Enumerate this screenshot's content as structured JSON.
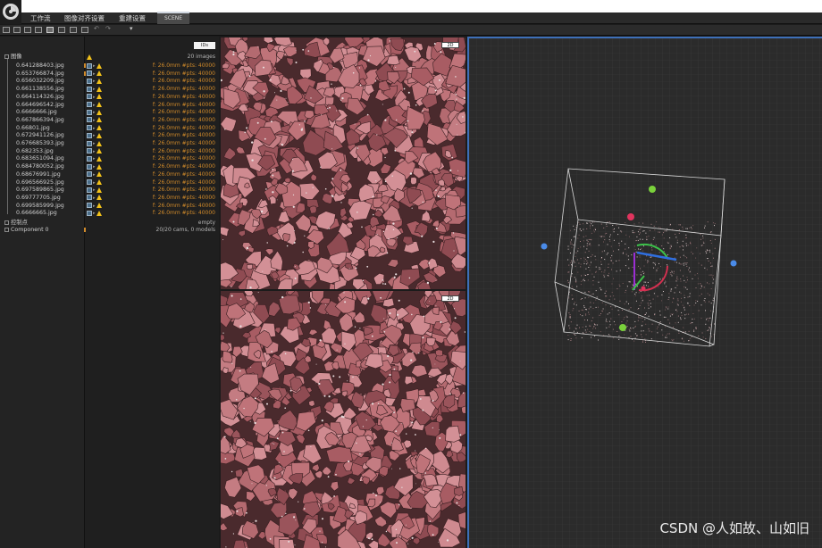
{
  "menu": {
    "items": [
      "工作流",
      "图像对齐设置",
      "重建设置"
    ],
    "scene_tab": "SCENE"
  },
  "tree": {
    "root_label": "图像",
    "images": [
      "0.641288403.jpg",
      "0.653766874.jpg",
      "0.656032209.jpg",
      "0.661138556.jpg",
      "0.664114326.jpg",
      "0.664696542.jpg",
      "0.6666666.jpg",
      "0.667866394.jpg",
      "0.66801.jpg",
      "0.672941126.jpg",
      "0.676685393.jpg",
      "0.682353.jpg",
      "0.683651094.jpg",
      "0.684780052.jpg",
      "0.68676991.jpg",
      "0.696566925.jpg",
      "0.697589865.jpg",
      "0.69777705.jpg",
      "0.699585999.jpg",
      "0.6666665.jpg"
    ],
    "control_points_label": "控制点",
    "component_label": "Component 0"
  },
  "info": {
    "ids_button": "IDs",
    "images_count": "20 images",
    "image_row_text": "f: 26.0mm #pts: 40000",
    "control_points_value": "empty",
    "component_value": "20/20 cams, 0 models"
  },
  "views": {
    "top_badge": "2D",
    "bottom_badge": "2D"
  },
  "watermark": "CSDN @人如故、山如旧",
  "colors": {
    "accent_blue": "#3d6fb8",
    "warning": "#f3c21a",
    "info_orange": "#d08a2a"
  }
}
